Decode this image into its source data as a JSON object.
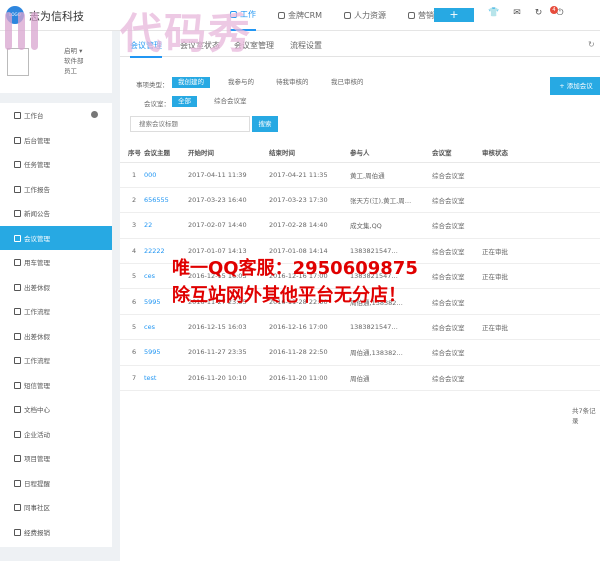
{
  "app": {
    "brand": "志为信科技",
    "logo_text": "LOGO"
  },
  "topnav": {
    "items": [
      "工作",
      "金牌CRM",
      "人力资源",
      "营销活动"
    ],
    "add_label": "+",
    "badge_count": "4",
    "active_index": 0
  },
  "user": {
    "label1": "启明 ▾",
    "label2": "软件部",
    "label3": "员工"
  },
  "sidebar": {
    "items": [
      "工作台",
      "后台管理",
      "任务管理",
      "工作报告",
      "新闻公告",
      "会议管理",
      "用车管理",
      "出差休假",
      "工作流程",
      "出差休假",
      "工作流程",
      "短信管理",
      "文档中心",
      "企业活动",
      "项目管理",
      "日程提醒",
      "同事社区",
      "经费报销"
    ],
    "active_index": 5
  },
  "tabs": {
    "items": [
      "会议管理",
      "会议室状态",
      "会议室管理",
      "流程设置"
    ],
    "active_index": 0
  },
  "filters": {
    "type_label": "事项类型：",
    "type_options": [
      "我创建的",
      "我参与的",
      "待我审核的",
      "我已审核的"
    ],
    "room_label": "会议室：",
    "room_options": [
      "全部",
      "综合会议室"
    ]
  },
  "add_button": "+ 添加会议",
  "search": {
    "placeholder": "搜索会议标题",
    "button": "搜索"
  },
  "table": {
    "headers": [
      "序号",
      "会议主题",
      "开始时间",
      "结束时间",
      "参与人",
      "会议室",
      "审核状态"
    ],
    "rows": [
      [
        "1",
        "000",
        "2017-04-11 11:39",
        "2017-04-21 11:35",
        "黄工,周伯通",
        "综合会议室",
        ""
      ],
      [
        "2",
        "656555",
        "2017-03-23 16:40",
        "2017-03-23 17:30",
        "张天方(江),黄工,周…",
        "综合会议室",
        ""
      ],
      [
        "3",
        "22",
        "2017-02-07 14:40",
        "2017-02-28 14:40",
        "成文集,QQ",
        "综合会议室",
        ""
      ],
      [
        "4",
        "22222",
        "2017-01-07 14:13",
        "2017-01-08 14:14",
        "1383821547…",
        "综合会议室",
        "正在审批"
      ],
      [
        "5",
        "ces",
        "2016-12-15 16:03",
        "2016-12-16 17:00",
        "1383821547…",
        "综合会议室",
        "正在审批"
      ],
      [
        "6",
        "5995",
        "2016-11-27 23:35",
        "2016-11-28 22:50",
        "周伯通,138382…",
        "综合会议室",
        ""
      ],
      [
        "5",
        "ces",
        "2016-12-15 16:03",
        "2016-12-16 17:00",
        "1383821547…",
        "综合会议室",
        "正在审批"
      ],
      [
        "6",
        "5995",
        "2016-11-27 23:35",
        "2016-11-28 22:50",
        "周伯通,138382…",
        "综合会议室",
        ""
      ],
      [
        "7",
        "test",
        "2016-11-20 10:10",
        "2016-11-20 11:00",
        "周伯通",
        "综合会议室",
        ""
      ]
    ]
  },
  "total": "共7条记录",
  "watermark": {
    "logo": "代码秀",
    "ad_line1": "唯一QQ客服：2950609875",
    "ad_line2": "除互站网外其他平台无分店！"
  },
  "colors": {
    "accent": "#27a9e3",
    "link": "#2196f3",
    "ad": "#e00000"
  }
}
